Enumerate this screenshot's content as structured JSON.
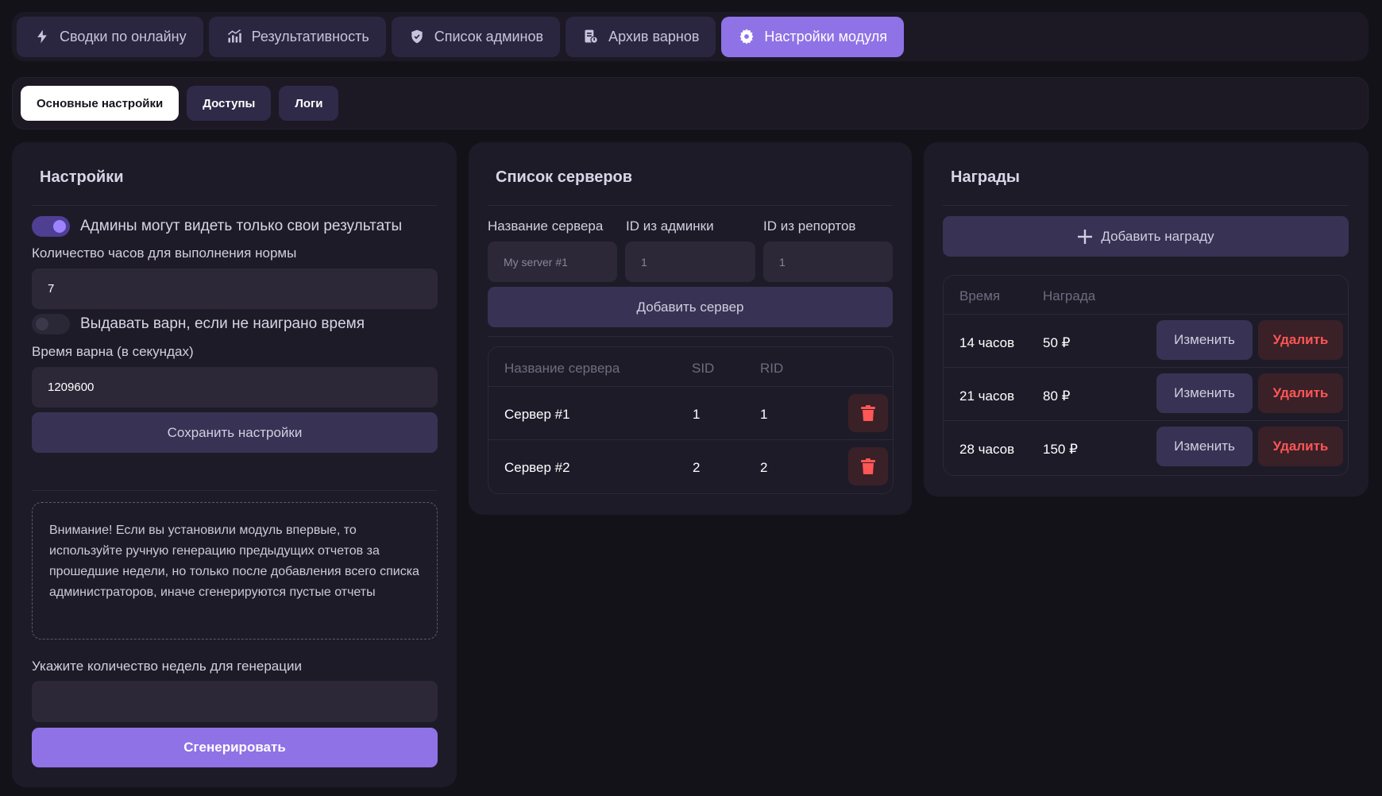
{
  "nav": {
    "tabs": [
      {
        "label": "Сводки по онлайну",
        "icon": "bolt-icon"
      },
      {
        "label": "Результативность",
        "icon": "chart-icon"
      },
      {
        "label": "Список админов",
        "icon": "shield-icon"
      },
      {
        "label": "Архив варнов",
        "icon": "archive-icon"
      },
      {
        "label": "Настройки модуля",
        "icon": "gear-icon",
        "active": true
      }
    ]
  },
  "subnav": {
    "tabs": [
      {
        "label": "Основные настройки",
        "active": true
      },
      {
        "label": "Доступы"
      },
      {
        "label": "Логи"
      }
    ]
  },
  "settings": {
    "title": "Настройки",
    "toggle_own_results": {
      "label": "Админы могут видеть только свои результаты",
      "on": true
    },
    "hours_label": "Количество часов для выполнения нормы",
    "hours_value": "7",
    "toggle_warn": {
      "label": "Выдавать варн, если не наиграно время",
      "on": false
    },
    "warn_time_label": "Время варна (в секундах)",
    "warn_time_value": "1209600",
    "save_label": "Сохранить настройки",
    "notice": "Внимание! Если вы установили модуль впервые, то используйте ручную генерацию предыдущих отчетов за прошедшие недели, но только после добавления всего списка администраторов, иначе сгенерируются пустые отчеты",
    "weeks_label": "Укажите количество недель для генерации",
    "weeks_value": "",
    "generate_label": "Сгенерировать"
  },
  "servers": {
    "title": "Список серверов",
    "form": {
      "name_label": "Название сервера",
      "name_placeholder": "My server #1",
      "admin_id_label": "ID из админки",
      "admin_id_placeholder": "1",
      "report_id_label": "ID из репортов",
      "report_id_placeholder": "1",
      "add_label": "Добавить сервер"
    },
    "columns": {
      "name": "Название сервера",
      "sid": "SID",
      "rid": "RID"
    },
    "rows": [
      {
        "name": "Сервер #1",
        "sid": "1",
        "rid": "1"
      },
      {
        "name": "Сервер #2",
        "sid": "2",
        "rid": "2"
      }
    ]
  },
  "rewards": {
    "title": "Награды",
    "add_label": "Добавить награду",
    "columns": {
      "time": "Время",
      "reward": "Награда"
    },
    "rows": [
      {
        "time": "14 часов",
        "reward": "50 ₽"
      },
      {
        "time": "21 часов",
        "reward": "80 ₽"
      },
      {
        "time": "28 часов",
        "reward": "150 ₽"
      }
    ],
    "edit_label": "Изменить",
    "delete_label": "Удалить"
  },
  "colors": {
    "accent": "#8f72e6",
    "background": "#141219",
    "card": "#1e1b28",
    "danger": "#ff5656"
  }
}
